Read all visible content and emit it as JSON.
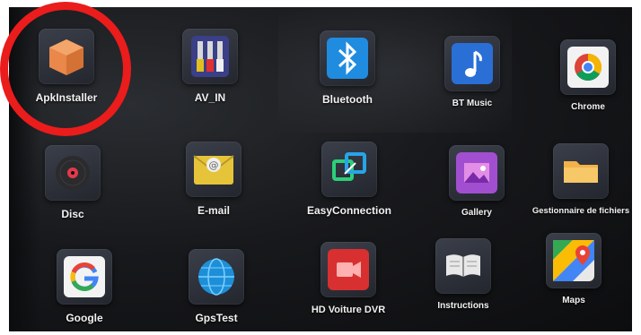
{
  "apps": [
    {
      "id": "apkinstaller",
      "label": "ApkInstaller",
      "icon": "box-icon"
    },
    {
      "id": "av-in",
      "label": "AV_IN",
      "icon": "rca-cable-icon"
    },
    {
      "id": "bluetooth",
      "label": "Bluetooth",
      "icon": "bluetooth-icon"
    },
    {
      "id": "bt-music",
      "label": "BT Music",
      "icon": "music-note-icon"
    },
    {
      "id": "chrome",
      "label": "Chrome",
      "icon": "chrome-icon"
    },
    {
      "id": "disc",
      "label": "Disc",
      "icon": "disc-icon"
    },
    {
      "id": "email",
      "label": "E-mail",
      "icon": "envelope-icon"
    },
    {
      "id": "easyconnection",
      "label": "EasyConnection",
      "icon": "connection-icon"
    },
    {
      "id": "gallery",
      "label": "Gallery",
      "icon": "picture-icon"
    },
    {
      "id": "file-manager",
      "label": "Gestionnaire de fichiers",
      "icon": "folder-icon"
    },
    {
      "id": "google",
      "label": "Google",
      "icon": "google-g-icon"
    },
    {
      "id": "gpstest",
      "label": "GpsTest",
      "icon": "globe-icon"
    },
    {
      "id": "hd-voiture-dvr",
      "label": "HD Voiture DVR",
      "icon": "video-camera-icon"
    },
    {
      "id": "instructions",
      "label": "Instructions",
      "icon": "book-icon"
    },
    {
      "id": "maps",
      "label": "Maps",
      "icon": "map-pin-icon"
    }
  ],
  "annotation": {
    "color": "#ea1c1c",
    "target": "apkinstaller"
  }
}
